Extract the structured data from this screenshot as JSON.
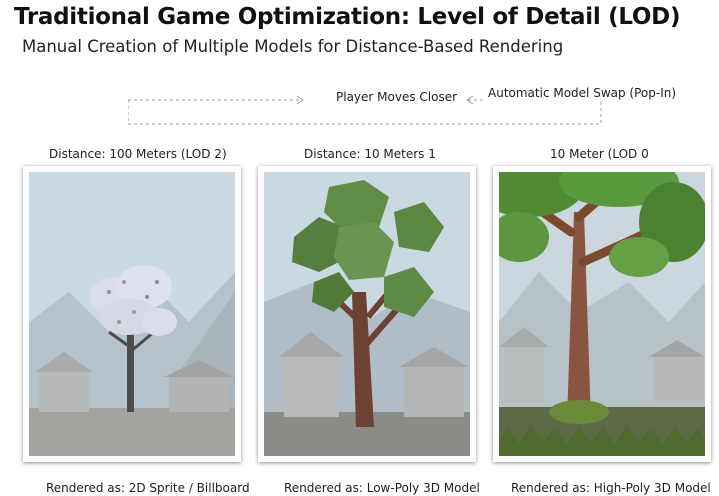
{
  "header": {
    "title": "Traditional Game Optimization: Level of Detail (LOD)",
    "subtitle": "Manual Creation of Multiple Models for Distance-Based Rendering"
  },
  "flow": {
    "center_label": "Player Moves Closer",
    "right_label": "Automatic Model Swap (Pop-In)"
  },
  "panels": [
    {
      "distance_label": "Distance: 100 Meters (LOD 2)",
      "caption": "Rendered as: 2D Sprite / Billboard"
    },
    {
      "distance_label": "Distance: 10 Meters 1",
      "caption": "Rendered as: Low-Poly 3D Model"
    },
    {
      "distance_label": "10 Meter (LOD 0",
      "caption": "Rendered as: High-Poly 3D Model"
    }
  ],
  "colors": {
    "sky": "#c9d8e2",
    "ground": "#9c9c98",
    "foliage_low_poly": "#5e8a45",
    "foliage_high_poly": "#4e8a35",
    "trunk": "#7a4a30"
  }
}
